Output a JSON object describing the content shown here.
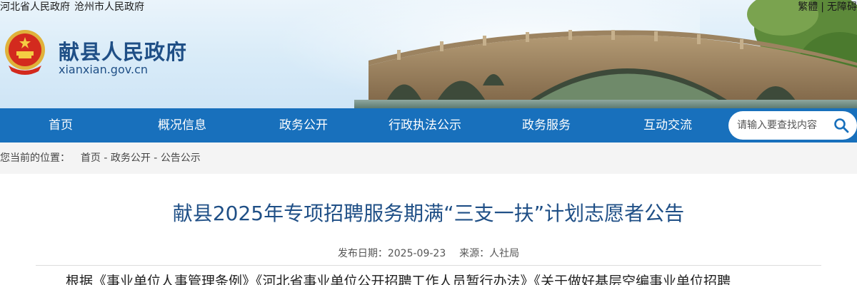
{
  "header": {
    "top_links": [
      "河北省人民政府",
      "沧州市人民政府"
    ],
    "lang_traditional": "繁體",
    "accessibility": "无障碍",
    "site_name": "献县人民政府",
    "site_domain": "xianxian.gov.cn"
  },
  "nav": {
    "items": [
      "首页",
      "概况信息",
      "政务公开",
      "行政执法公示",
      "政务服务",
      "互动交流"
    ]
  },
  "search": {
    "placeholder": "请输入要查找内容"
  },
  "breadcrumb": {
    "label": "您当前的位置：",
    "items": [
      "首页",
      "政务公开",
      "公告公示"
    ],
    "separator": " - "
  },
  "article": {
    "title": "献县2025年专项招聘服务期满“三支一扶”计划志愿者公告",
    "date_label": "发布日期：",
    "date": "2025-09-23",
    "source_label": "来源：",
    "source": "人社局",
    "body_first_line": "根据《事业单位人事管理条例》《河北省事业单位公开招聘工作人员暂行办法》《关于做好基层空编事业单位招聘"
  },
  "colors": {
    "nav_bg": "#1870bc",
    "title_blue": "#1f4f86"
  }
}
